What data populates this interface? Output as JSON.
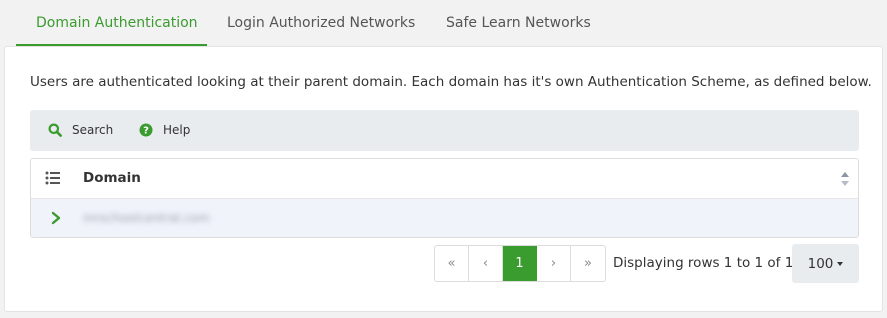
{
  "tabs": [
    {
      "label": "Domain Authentication",
      "active": true
    },
    {
      "label": "Login Authorized Networks",
      "active": false
    },
    {
      "label": "Safe Learn Networks",
      "active": false
    }
  ],
  "description": "Users are authenticated looking at their parent domain. Each domain has it's own Authentication Scheme, as defined below.",
  "toolbar": {
    "search_label": "Search",
    "search_icon": "search-icon",
    "help_label": "Help",
    "help_icon": "help-circle-icon"
  },
  "table": {
    "columns": [
      "Domain"
    ],
    "rows": [
      {
        "domain": "mrschoolcentral.com"
      }
    ]
  },
  "pagination": {
    "first": "«",
    "prev": "‹",
    "current": "1",
    "next": "›",
    "last": "»",
    "display_text": "Displaying rows 1 to 1 of 1",
    "page_size": "100"
  },
  "colors": {
    "accent": "#3a9b2f",
    "toolbar_bg": "#e9ecef",
    "row_bg": "#f1f3fb"
  }
}
